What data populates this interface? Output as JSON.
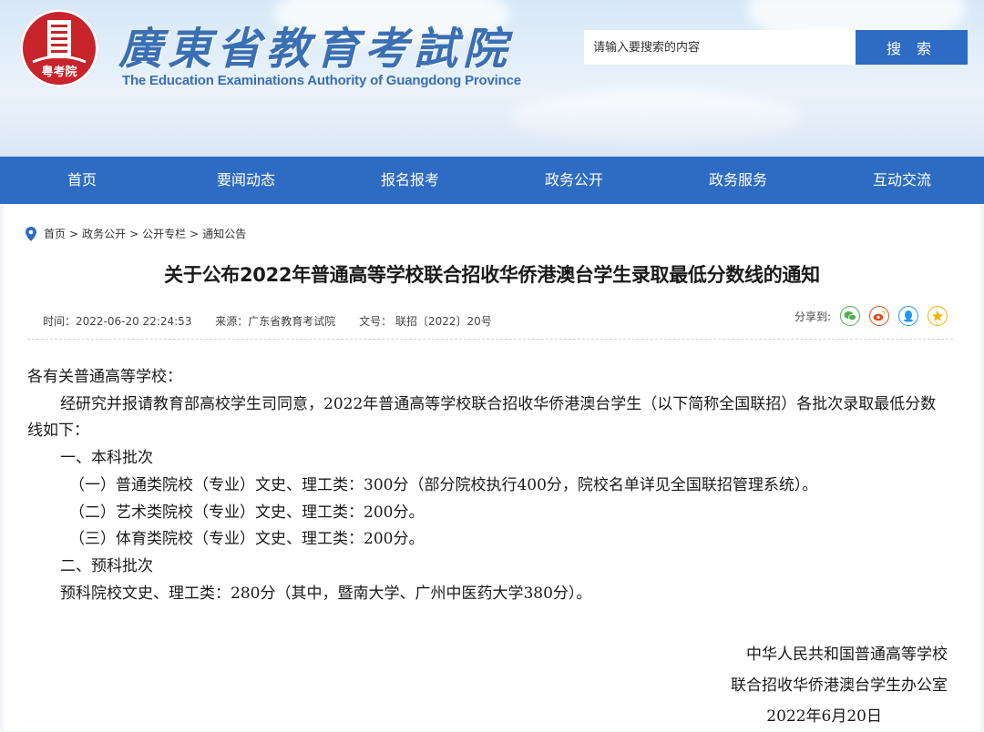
{
  "header": {
    "site_title": "廣東省教育考試院",
    "site_subtitle": "The Education Examinations Authority of Guangdong Province",
    "emblem_text": "粤考院"
  },
  "search": {
    "placeholder": "请输入要搜索的内容",
    "button_label": "搜 索"
  },
  "nav": {
    "items": [
      {
        "label": "首页"
      },
      {
        "label": "要闻动态"
      },
      {
        "label": "报名报考"
      },
      {
        "label": "政务公开"
      },
      {
        "label": "政务服务"
      },
      {
        "label": "互动交流"
      }
    ]
  },
  "breadcrumb": [
    "首页",
    "政务公开",
    "公开专栏",
    "通知公告"
  ],
  "article": {
    "title": "关于公布2022年普通高等学校联合招收华侨港澳台学生录取最低分数线的通知",
    "time": "时间：2022-06-20 22:24:53",
    "source": "来源：广东省教育考试院",
    "doc_no": "文号：  联招〔2022〕20号",
    "share_label": "分享到:",
    "greeting": "各有关普通高等学校：",
    "intro": "经研究并报请教育部高校学生司同意，2022年普通高等学校联合招收华侨港澳台学生（以下简称全国联招）各批次录取最低分数线如下：",
    "section1": "一、本科批次",
    "item1": "（一）普通类院校（专业）文史、理工类：300分（部分院校执行400分，院校名单详见全国联招管理系统）。",
    "item2": "（二）艺术类院校（专业）文史、理工类：200分。",
    "item3": "（三）体育类院校（专业）文史、理工类：200分。",
    "section2": "二、预科批次",
    "item4": "预科院校文史、理工类：280分（其中，暨南大学、广州中医药大学380分）。",
    "sign_org1": "中华人民共和国普通高等学校",
    "sign_org2": "联合招收华侨港澳台学生办公室",
    "sign_date": "2022年6月20日"
  },
  "colors": {
    "nav_bg": "#2e6cc3",
    "title_blue": "#3a6fb3",
    "emblem_red": "#c8242b",
    "wechat": "#4caf50",
    "weibo": "#e64a19",
    "qq": "#2196f3",
    "qzone": "#f4b400"
  },
  "icons": [
    "location-pin-icon",
    "wechat-icon",
    "weibo-icon",
    "qq-icon",
    "qzone-icon"
  ]
}
